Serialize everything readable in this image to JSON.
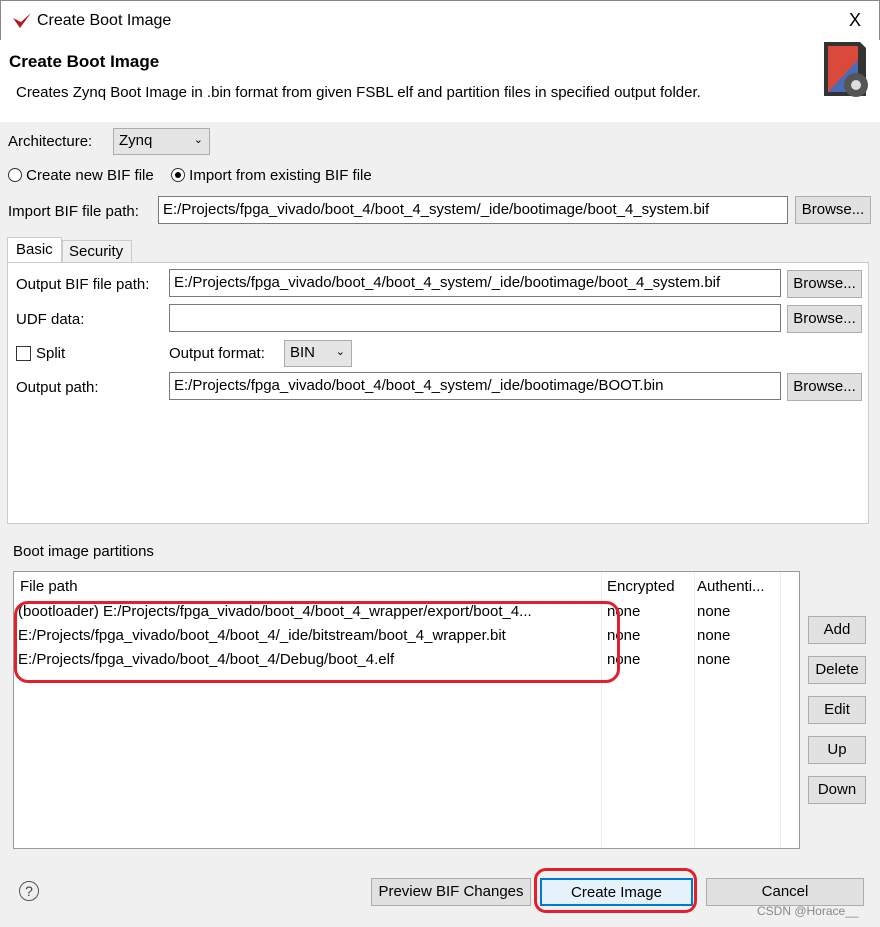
{
  "window": {
    "title": "Create Boot Image",
    "close": "X"
  },
  "header": {
    "title": "Create Boot Image",
    "description": "Creates Zynq Boot Image in .bin format from given FSBL elf and partition files in specified output folder."
  },
  "architecture": {
    "label": "Architecture:",
    "value": "Zynq"
  },
  "bif_mode": {
    "create_label": "Create new BIF file",
    "import_label": "Import from existing BIF file",
    "selected": "import"
  },
  "import_bif": {
    "label": "Import BIF file path:",
    "value": "E:/Projects/fpga_vivado/boot_4/boot_4_system/_ide/bootimage/boot_4_system.bif",
    "browse": "Browse..."
  },
  "tabs": [
    {
      "label": "Basic",
      "active": true
    },
    {
      "label": "Security",
      "active": false
    }
  ],
  "basic": {
    "output_bif": {
      "label": "Output BIF file path:",
      "value": "E:/Projects/fpga_vivado/boot_4/boot_4_system/_ide/bootimage/boot_4_system.bif",
      "browse": "Browse..."
    },
    "udf": {
      "label": "UDF data:",
      "value": "",
      "browse": "Browse..."
    },
    "split": {
      "label": "Split",
      "checked": false
    },
    "output_format": {
      "label": "Output format:",
      "value": "BIN"
    },
    "output_path": {
      "label": "Output path:",
      "value": "E:/Projects/fpga_vivado/boot_4/boot_4_system/_ide/bootimage/BOOT.bin",
      "browse": "Browse..."
    }
  },
  "partitions": {
    "label": "Boot image partitions",
    "columns": [
      "File path",
      "Encrypted",
      "Authenti..."
    ],
    "rows": [
      {
        "path": "(bootloader) E:/Projects/fpga_vivado/boot_4/boot_4_wrapper/export/boot_4...",
        "encrypted": "none",
        "auth": "none"
      },
      {
        "path": "E:/Projects/fpga_vivado/boot_4/boot_4/_ide/bitstream/boot_4_wrapper.bit",
        "encrypted": "none",
        "auth": "none"
      },
      {
        "path": "E:/Projects/fpga_vivado/boot_4/boot_4/Debug/boot_4.elf",
        "encrypted": "none",
        "auth": "none"
      }
    ],
    "buttons": {
      "add": "Add",
      "delete": "Delete",
      "edit": "Edit",
      "up": "Up",
      "down": "Down"
    }
  },
  "footer": {
    "help": "?",
    "preview": "Preview BIF Changes",
    "create": "Create Image",
    "cancel": "Cancel",
    "watermark": "CSDN @Horace__"
  },
  "colors": {
    "annotation": "#e0202a",
    "accent": "#0078d7"
  }
}
